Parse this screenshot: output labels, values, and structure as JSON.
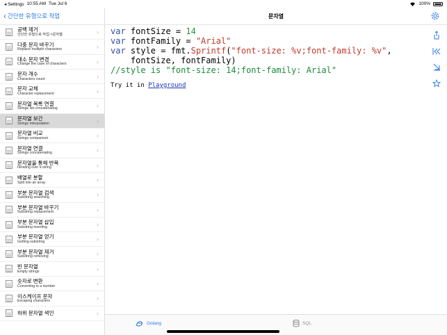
{
  "status": {
    "carrier": "◂ Settings",
    "time": "10:55 AM",
    "date": "Tue Jul 6",
    "battery": "100%"
  },
  "sidebar": {
    "back_label": "간단한 유형으로 작업",
    "items": [
      {
        "title": "공백 제거",
        "subtitle": "간단한 유형으로 작업->문자열",
        "selected": false
      },
      {
        "title": "다중 문자 바꾸기",
        "subtitle": "Replace multiple characters",
        "selected": false
      },
      {
        "title": "대소 문자 변경",
        "subtitle": "Change the case of characters",
        "selected": false
      },
      {
        "title": "문자 개수",
        "subtitle": "Characters count",
        "selected": false
      },
      {
        "title": "문자 교체",
        "subtitle": "Character replacement",
        "selected": false
      },
      {
        "title": "문자열 목록 연결",
        "subtitle": "Strings list concatenating",
        "selected": false
      },
      {
        "title": "문자열 보간",
        "subtitle": "Strings interpolation",
        "selected": true
      },
      {
        "title": "문자열 비교",
        "subtitle": "Strings comparison",
        "selected": false
      },
      {
        "title": "문자열 연결",
        "subtitle": "Strings concatenating",
        "selected": false
      },
      {
        "title": "문자열을 통해 반복",
        "subtitle": "Iterating over a string",
        "selected": false
      },
      {
        "title": "배열로 분할",
        "subtitle": "Split into an array",
        "selected": false
      },
      {
        "title": "부분 문자열 검색",
        "subtitle": "Substring searching",
        "selected": false
      },
      {
        "title": "부분 문자열 바꾸기",
        "subtitle": "Substring replacement",
        "selected": false
      },
      {
        "title": "부분 문자열 삽입",
        "subtitle": "Substring inserting",
        "selected": false
      },
      {
        "title": "부분 문자열 얻기",
        "subtitle": "Getting substring",
        "selected": false
      },
      {
        "title": "부분 문자열 제거",
        "subtitle": "Substring removing",
        "selected": false
      },
      {
        "title": "빈 문자열",
        "subtitle": "Empty strings",
        "selected": false
      },
      {
        "title": "숫자로 변환",
        "subtitle": "Converting to a number",
        "selected": false
      },
      {
        "title": "이스케이프 문자",
        "subtitle": "Escaping characters",
        "selected": false
      },
      {
        "title": "하위 문자열 색인",
        "subtitle": "",
        "selected": false
      }
    ]
  },
  "detail": {
    "title": "문자열",
    "code_lines": [
      [
        {
          "t": "var ",
          "c": "kw"
        },
        {
          "t": "fontSize = ",
          "c": ""
        },
        {
          "t": "14",
          "c": "num"
        }
      ],
      [
        {
          "t": "var ",
          "c": "kw"
        },
        {
          "t": "fontFamily = ",
          "c": ""
        },
        {
          "t": "\"Arial\"",
          "c": "str"
        }
      ],
      [
        {
          "t": "var ",
          "c": "kw"
        },
        {
          "t": "style = fmt.",
          "c": ""
        },
        {
          "t": "Sprintf",
          "c": "fn"
        },
        {
          "t": "(",
          "c": ""
        },
        {
          "t": "\"font-size: %v;font-family: %v\"",
          "c": "str"
        },
        {
          "t": ",",
          "c": ""
        }
      ],
      [
        {
          "t": "    fontSize, fontFamily)",
          "c": ""
        }
      ],
      [
        {
          "t": "//style is \"font-size: 14;font-family: Arial\"",
          "c": "cm"
        }
      ]
    ],
    "try_prefix": "Try it in ",
    "try_link": "Playground"
  },
  "tabs": [
    {
      "label": "Golang",
      "icon": "golang-icon",
      "active": true
    },
    {
      "label": "SQL",
      "icon": "database-icon",
      "active": false
    }
  ],
  "colors": {
    "accent": "#2a7ae2",
    "keyword": "#2f4ea8",
    "string": "#c0392b",
    "number": "#27944a",
    "comment": "#1b8a3a"
  }
}
